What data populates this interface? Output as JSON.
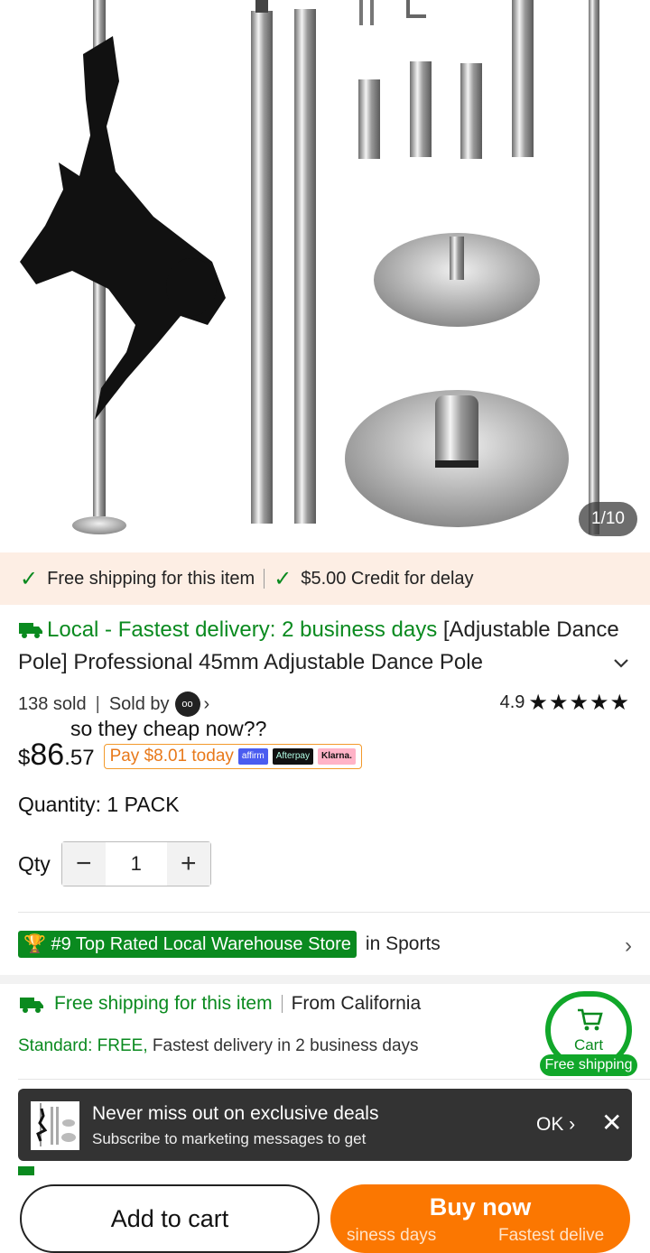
{
  "gallery": {
    "counter": "1/10"
  },
  "shipping_strip": {
    "item1": "Free shipping for this item",
    "item2": "$5.00 Credit for delay"
  },
  "product": {
    "delivery_badge": "Local - Fastest delivery: 2 business days",
    "title": "[Adjustable Dance Pole] Professional 45mm Adjustable Dance Pole",
    "sold": "138 sold",
    "sold_by": "Sold by",
    "rating": "4.9",
    "stars": "★★★★★",
    "price_symbol": "$",
    "price_int": "86",
    "price_dec": ".57",
    "pay_today": "Pay $8.01 today",
    "pay_logos": [
      "affirm",
      "Afterpay",
      "Klarna."
    ]
  },
  "comment_overlay": "so they cheap now??",
  "quantity": {
    "label": "Quantity: 1 PACK",
    "qty_label": "Qty",
    "value": "1",
    "minus": "−",
    "plus": "+"
  },
  "ranking": {
    "badge": "#9 Top Rated Local Warehouse Store",
    "category": "in Sports"
  },
  "shipping_info": {
    "title": "Free shipping for this item",
    "from": "From California",
    "standard_label": "Standard: FREE,",
    "standard_detail": " Fastest delivery in 2 business days"
  },
  "cart_float": {
    "label": "Cart",
    "badge": "Free shipping"
  },
  "toast": {
    "title": "Never miss out on exclusive deals",
    "subtitle": "Subscribe to marketing messages to get",
    "ok": "OK",
    "close": "✕"
  },
  "bottom": {
    "add_to_cart": "Add to cart",
    "buy_now": "Buy now",
    "sub_left": "siness days",
    "sub_right": "Fastest delive"
  },
  "colors": {
    "green": "#0a8a1f",
    "orange": "#fb7701",
    "strip_bg": "#fdeee4"
  }
}
